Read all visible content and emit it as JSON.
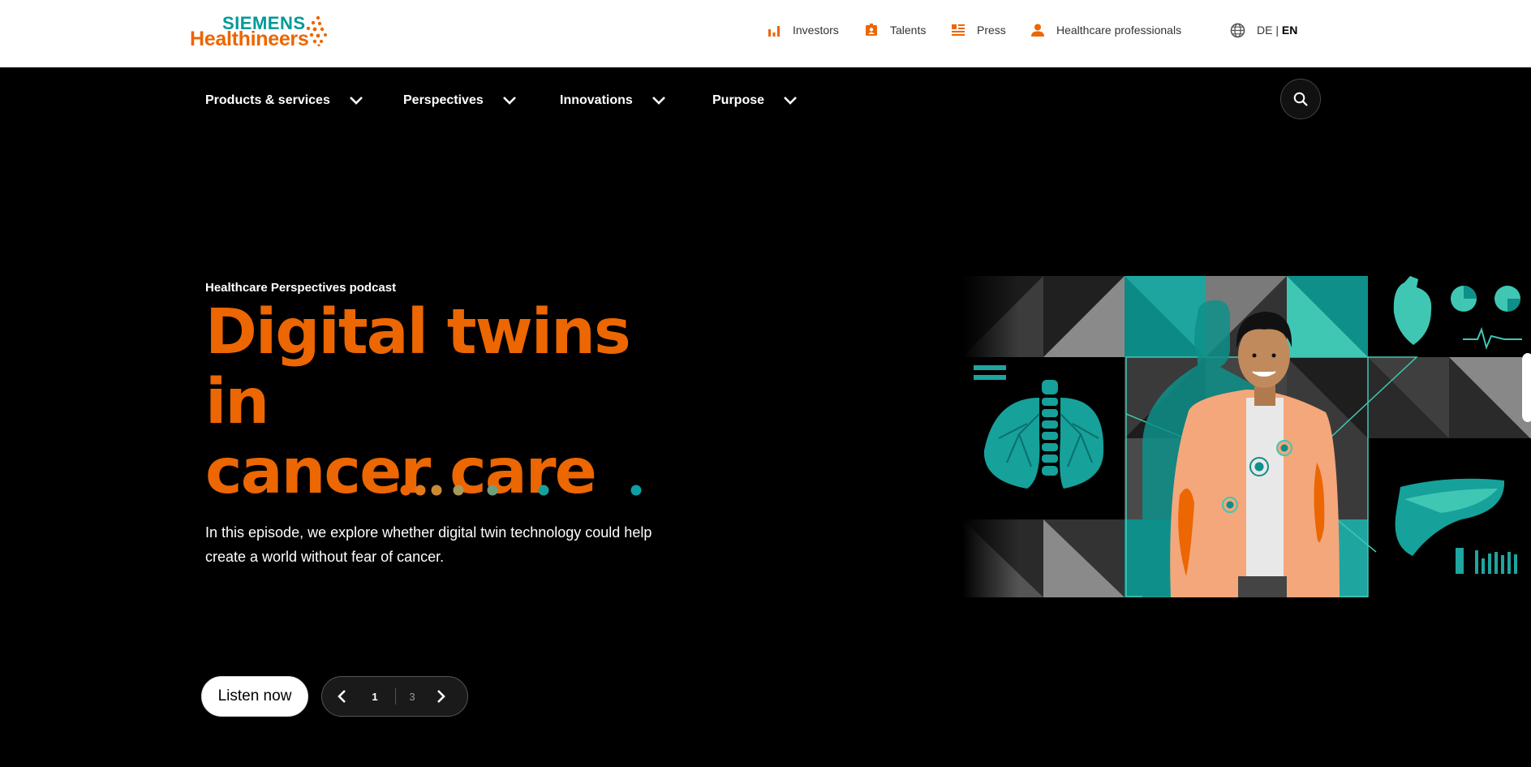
{
  "brand": {
    "line1": "SIEMENS",
    "line2": "Healthineers"
  },
  "utility_nav": [
    {
      "label": "Investors",
      "icon": "bar-chart-icon"
    },
    {
      "label": "Talents",
      "icon": "id-badge-icon"
    },
    {
      "label": "Press",
      "icon": "news-icon"
    },
    {
      "label": "Healthcare professionals",
      "icon": "user-icon"
    }
  ],
  "language": {
    "icon": "globe-icon",
    "de": "DE",
    "separator": "|",
    "en": "EN"
  },
  "main_nav": [
    {
      "label": "Products & services"
    },
    {
      "label": "Perspectives"
    },
    {
      "label": "Innovations"
    },
    {
      "label": "Purpose"
    }
  ],
  "search": {
    "icon": "search-icon"
  },
  "hero": {
    "eyebrow": "Healthcare Perspectives podcast",
    "headline_line1": "Digital twins in",
    "headline_line2": "cancer care",
    "description_line1": "In this episode, we explore whether digital twin technology could help",
    "description_line2": "create a world without fear of cancer.",
    "cta": "Listen now",
    "pager": {
      "current": "1",
      "total": "3"
    }
  },
  "colors": {
    "brand_orange": "#ec6602",
    "brand_teal": "#009999",
    "background": "#000000"
  }
}
